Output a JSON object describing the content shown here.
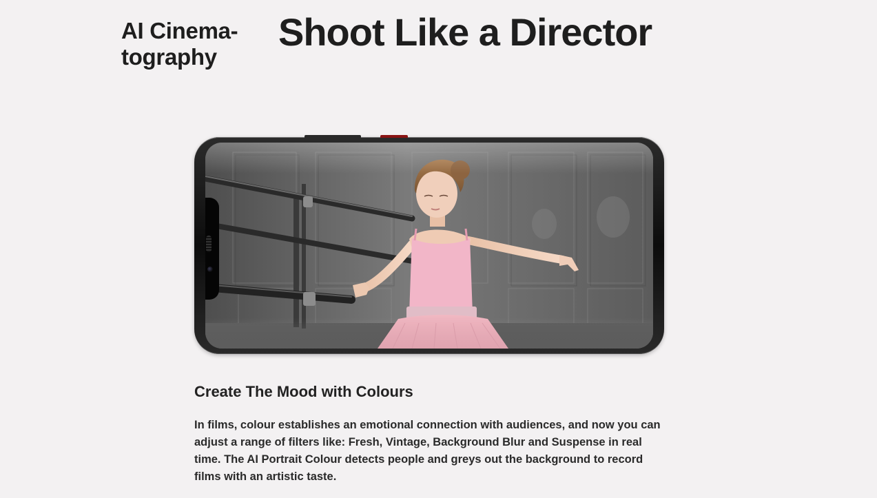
{
  "header": {
    "eyebrow_line1": "AI Cinema-",
    "eyebrow_line2": "tography",
    "headline": "Shoot Like a Director"
  },
  "feature": {
    "title": "Create The Mood with Colours",
    "body": "In films, colour establishes an emotional connection with audiences, and now you can adjust a range of filters like: Fresh, Vintage, Background Blur and Suspense in real time. The AI Portrait Colour detects people and greys out the background to record films with an artistic taste."
  },
  "colors": {
    "page_background": "#f3f1f2",
    "text": "#1e1e1e",
    "phone_body": "#111111",
    "power_button": "#8a1414",
    "leotard_pink": "#f2b6c8",
    "tutu_pink": "#e9a7b4"
  },
  "icons": {
    "speaker": "earpiece-speaker-icon",
    "camera": "front-camera-icon"
  }
}
